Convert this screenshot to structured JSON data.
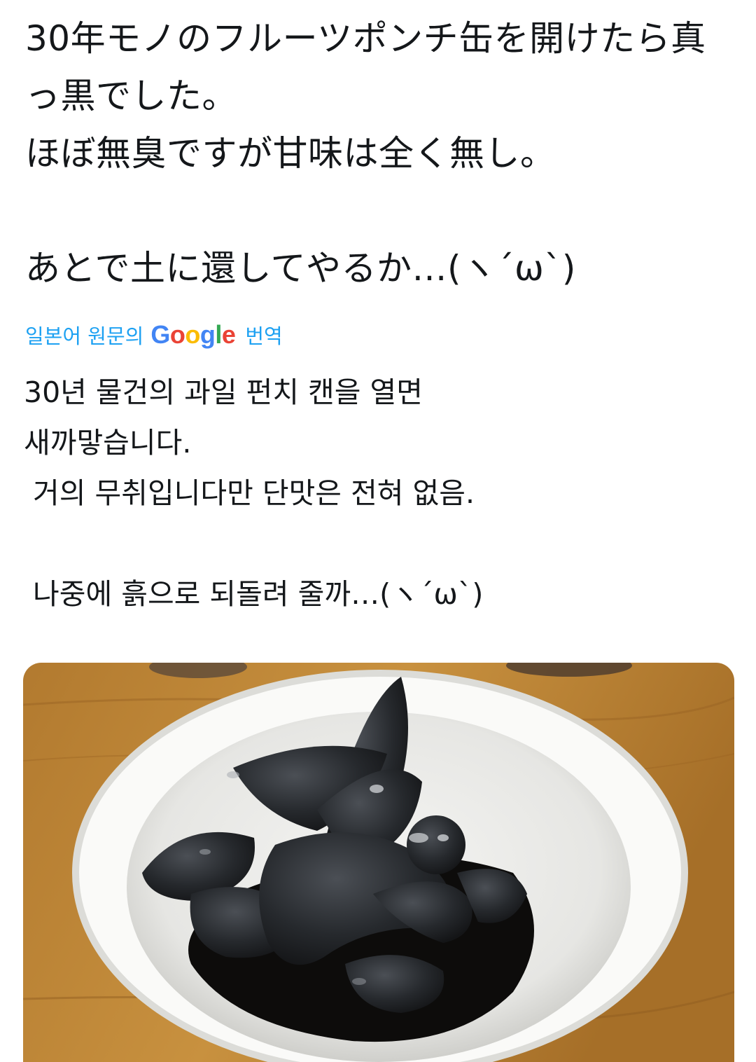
{
  "tweet": {
    "original_text": "30年モノのフルーツポンチ缶を開けたら真っ黒でした。\nほぼ無臭ですが甘味は全く無し。\n\nあとで土に還してやるか…(ヽ´ω`)",
    "translation_label": "일본어 원문의",
    "translation_provider": "Google",
    "translation_suffix": "번역",
    "translated_text": "30년 물건의 과일 펀치 캔을 열면\n새까맣습니다.\n 거의 무취입니다만 단맛은 전혀 없음.\n\n 나중에 흙으로 되돌려 줄까…(ヽ´ω`)"
  },
  "media": {
    "kind": "photo",
    "subject": "blackened fruit pieces in a white bowl"
  },
  "colors": {
    "link_blue": "#1da1f2",
    "google_blue": "#4285f4",
    "google_red": "#ea4335",
    "google_yellow": "#fbbc05",
    "google_green": "#34a853"
  }
}
